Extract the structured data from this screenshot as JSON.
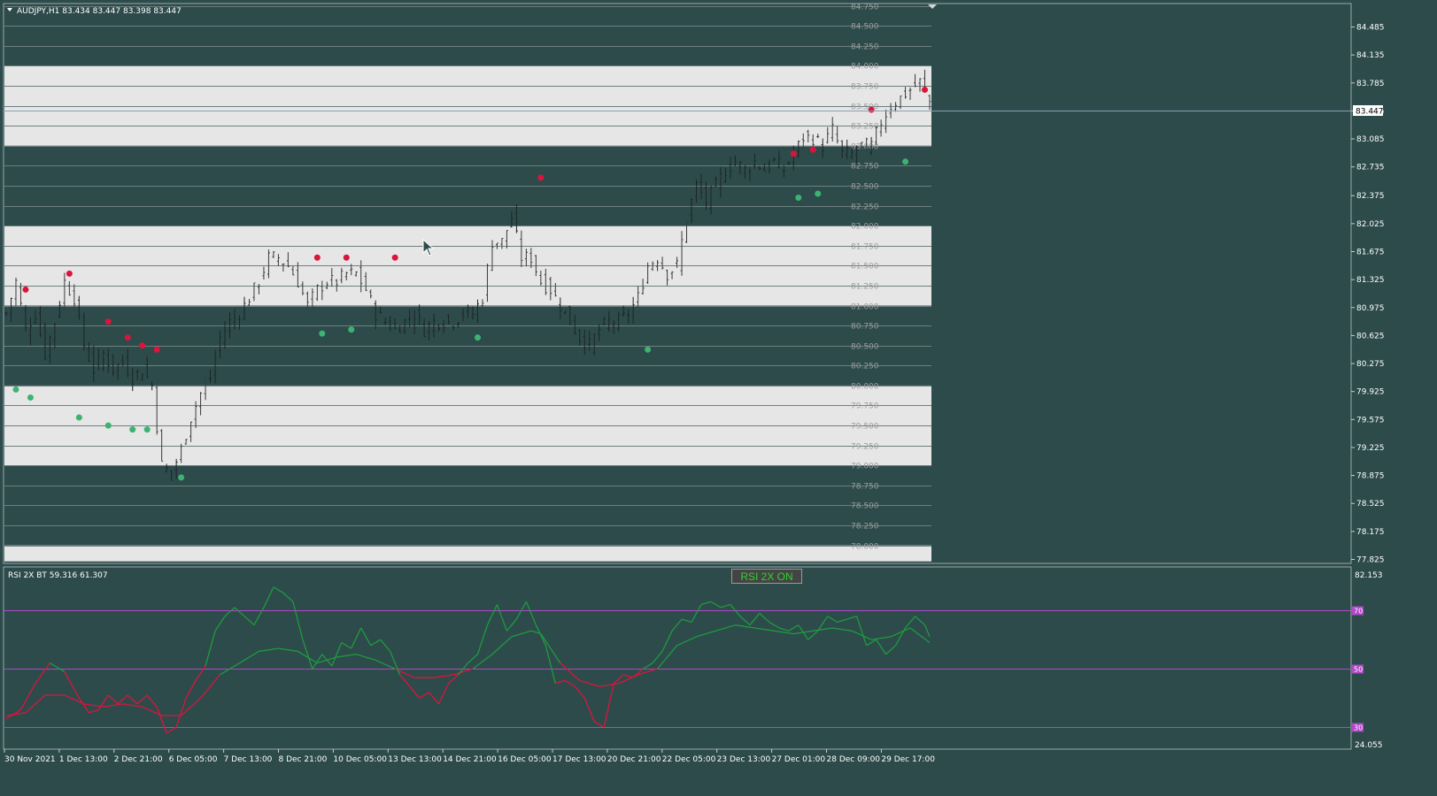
{
  "main_title": "AUDJPY,H1  83.434 83.447 83.398 83.447",
  "rsi_title": "RSI 2X BT 59.316 61.307",
  "rsi_button_label": "RSI 2X ON",
  "current_price_label": "83.447",
  "colors": {
    "background": "#2d4b4b",
    "band": "#e6e6e6",
    "bull": "#2a2a2a",
    "bear": "#2a2a2a",
    "buy_dot": "#3cb371",
    "sell_dot": "#dc143c",
    "rsi_bull": "#1f9a3f",
    "rsi_bear": "#dc143c",
    "rsi_level": "#b048c8",
    "price_line": "#8aa0b0"
  },
  "chart_data": [
    {
      "type": "candlestick",
      "symbol": "AUDJPY",
      "timeframe": "H1",
      "ylim": [
        77.825,
        84.485
      ],
      "price_axis_ticks": [
        "84.485",
        "84.135",
        "83.785",
        "83.435",
        "83.085",
        "82.735",
        "82.375",
        "82.025",
        "81.675",
        "81.325",
        "80.975",
        "80.625",
        "80.275",
        "79.925",
        "79.575",
        "79.225",
        "78.875",
        "78.525",
        "78.175",
        "77.825"
      ],
      "level_labels": [
        "84.750",
        "84.500",
        "84.250",
        "84.000",
        "83.750",
        "83.500",
        "83.250",
        "83.000",
        "82.750",
        "82.500",
        "82.250",
        "82.000",
        "81.750",
        "81.500",
        "81.250",
        "81.000",
        "80.750",
        "80.500",
        "80.250",
        "80.000",
        "79.750",
        "79.500",
        "79.250",
        "79.000",
        "78.750",
        "78.500",
        "78.250",
        "78.000"
      ],
      "bands": [
        [
          83.0,
          84.0
        ],
        [
          81.0,
          82.0
        ],
        [
          79.0,
          80.0
        ],
        [
          77.8,
          78.0
        ]
      ],
      "x_labels": [
        "30 Nov 2021",
        "1 Dec 13:00",
        "2 Dec 21:00",
        "6 Dec 05:00",
        "7 Dec 13:00",
        "8 Dec 21:00",
        "10 Dec 05:00",
        "13 Dec 13:00",
        "14 Dec 21:00",
        "16 Dec 05:00",
        "17 Dec 13:00",
        "20 Dec 21:00",
        "22 Dec 05:00",
        "23 Dec 13:00",
        "27 Dec 01:00",
        "28 Dec 09:00",
        "29 Dec 17:00"
      ],
      "current_price": 83.447,
      "close_path": [
        [
          0,
          80.9
        ],
        [
          2,
          81.3
        ],
        [
          4,
          80.7
        ],
        [
          6,
          80.9
        ],
        [
          8,
          80.4
        ],
        [
          10,
          80.8
        ],
        [
          12,
          81.3
        ],
        [
          14,
          81.1
        ],
        [
          16,
          80.5
        ],
        [
          18,
          80.2
        ],
        [
          20,
          80.4
        ],
        [
          22,
          80.2
        ],
        [
          24,
          80.3
        ],
        [
          26,
          80.1
        ],
        [
          28,
          80.2
        ],
        [
          30,
          80.0
        ],
        [
          32,
          79.0
        ],
        [
          34,
          78.9
        ],
        [
          36,
          79.2
        ],
        [
          38,
          79.6
        ],
        [
          40,
          79.9
        ],
        [
          42,
          80.1
        ],
        [
          44,
          80.6
        ],
        [
          46,
          80.8
        ],
        [
          48,
          80.9
        ],
        [
          50,
          81.1
        ],
        [
          52,
          81.3
        ],
        [
          54,
          81.6
        ],
        [
          56,
          81.6
        ],
        [
          58,
          81.5
        ],
        [
          60,
          81.3
        ],
        [
          62,
          81.0
        ],
        [
          64,
          81.2
        ],
        [
          66,
          81.3
        ],
        [
          68,
          81.3
        ],
        [
          70,
          81.4
        ],
        [
          72,
          81.4
        ],
        [
          74,
          81.2
        ],
        [
          76,
          80.9
        ],
        [
          78,
          80.8
        ],
        [
          80,
          80.7
        ],
        [
          82,
          80.8
        ],
        [
          84,
          80.9
        ],
        [
          86,
          80.7
        ],
        [
          88,
          80.8
        ],
        [
          90,
          80.8
        ],
        [
          92,
          80.8
        ],
        [
          94,
          80.9
        ],
        [
          96,
          80.9
        ],
        [
          98,
          81.1
        ],
        [
          100,
          81.8
        ],
        [
          102,
          81.8
        ],
        [
          104,
          82.1
        ],
        [
          106,
          81.6
        ],
        [
          108,
          81.6
        ],
        [
          110,
          81.3
        ],
        [
          112,
          81.2
        ],
        [
          114,
          81.0
        ],
        [
          116,
          80.8
        ],
        [
          118,
          80.6
        ],
        [
          120,
          80.5
        ],
        [
          122,
          80.7
        ],
        [
          124,
          80.8
        ],
        [
          126,
          80.8
        ],
        [
          128,
          80.9
        ],
        [
          130,
          81.1
        ],
        [
          132,
          81.5
        ],
        [
          134,
          81.6
        ],
        [
          136,
          81.4
        ],
        [
          138,
          81.5
        ],
        [
          140,
          82.1
        ],
        [
          142,
          82.5
        ],
        [
          144,
          82.3
        ],
        [
          146,
          82.5
        ],
        [
          148,
          82.7
        ],
        [
          150,
          82.8
        ],
        [
          152,
          82.7
        ],
        [
          154,
          82.8
        ],
        [
          156,
          82.7
        ],
        [
          158,
          82.8
        ],
        [
          160,
          82.7
        ],
        [
          162,
          82.9
        ],
        [
          164,
          83.1
        ],
        [
          166,
          83.1
        ],
        [
          168,
          83.0
        ],
        [
          170,
          83.2
        ],
        [
          172,
          82.9
        ],
        [
          174,
          82.9
        ],
        [
          176,
          83.0
        ],
        [
          178,
          83.0
        ],
        [
          180,
          83.3
        ],
        [
          182,
          83.5
        ],
        [
          184,
          83.6
        ],
        [
          186,
          83.7
        ],
        [
          188,
          83.8
        ],
        [
          190,
          83.55
        ]
      ],
      "n_bars": 191,
      "sell_signals": [
        [
          4,
          81.2
        ],
        [
          13,
          81.4
        ],
        [
          21,
          80.8
        ],
        [
          25,
          80.6
        ],
        [
          28,
          80.5
        ],
        [
          31,
          80.45
        ],
        [
          64,
          81.6
        ],
        [
          70,
          81.6
        ],
        [
          80,
          81.6
        ],
        [
          110,
          82.6
        ],
        [
          162,
          82.9
        ],
        [
          166,
          82.95
        ],
        [
          178,
          83.45
        ],
        [
          189,
          83.7
        ]
      ],
      "buy_signals": [
        [
          2,
          79.95
        ],
        [
          5,
          79.85
        ],
        [
          15,
          79.6
        ],
        [
          21,
          79.5
        ],
        [
          26,
          79.45
        ],
        [
          29,
          79.45
        ],
        [
          36,
          78.85
        ],
        [
          65,
          80.65
        ],
        [
          71,
          80.7
        ],
        [
          97,
          80.6
        ],
        [
          132,
          80.45
        ],
        [
          163,
          82.35
        ],
        [
          167,
          82.4
        ],
        [
          185,
          82.8
        ]
      ]
    },
    {
      "type": "line",
      "title": "RSI 2X BT 59.316 61.307",
      "ylim": [
        24.055,
        82.153
      ],
      "axis_ticks": [
        "82.153",
        "24.055"
      ],
      "levels": [
        70,
        50,
        30
      ],
      "fast": [
        [
          0,
          33
        ],
        [
          3,
          36
        ],
        [
          6,
          45
        ],
        [
          9,
          52
        ],
        [
          12,
          49
        ],
        [
          15,
          40
        ],
        [
          17,
          35
        ],
        [
          19,
          36
        ],
        [
          21,
          41
        ],
        [
          23,
          38
        ],
        [
          25,
          41
        ],
        [
          27,
          38
        ],
        [
          29,
          41
        ],
        [
          31,
          37
        ],
        [
          33,
          28
        ],
        [
          35,
          30
        ],
        [
          37,
          40
        ],
        [
          39,
          46
        ],
        [
          41,
          51
        ],
        [
          43,
          63
        ],
        [
          45,
          68
        ],
        [
          47,
          71
        ],
        [
          49,
          68
        ],
        [
          51,
          65
        ],
        [
          53,
          71
        ],
        [
          55,
          78
        ],
        [
          57,
          76
        ],
        [
          59,
          73
        ],
        [
          61,
          60
        ],
        [
          63,
          50
        ],
        [
          65,
          55
        ],
        [
          67,
          51
        ],
        [
          69,
          59
        ],
        [
          71,
          57
        ],
        [
          73,
          64
        ],
        [
          75,
          58
        ],
        [
          77,
          60
        ],
        [
          79,
          56
        ],
        [
          81,
          48
        ],
        [
          83,
          44
        ],
        [
          85,
          40
        ],
        [
          87,
          42
        ],
        [
          89,
          38
        ],
        [
          91,
          45
        ],
        [
          93,
          48
        ],
        [
          95,
          52
        ],
        [
          97,
          55
        ],
        [
          99,
          65
        ],
        [
          101,
          72
        ],
        [
          103,
          63
        ],
        [
          105,
          67
        ],
        [
          107,
          73
        ],
        [
          109,
          65
        ],
        [
          111,
          58
        ],
        [
          113,
          45
        ],
        [
          115,
          46
        ],
        [
          117,
          44
        ],
        [
          119,
          40
        ],
        [
          121,
          32
        ],
        [
          123,
          30
        ],
        [
          125,
          45
        ],
        [
          127,
          48
        ],
        [
          129,
          47
        ],
        [
          131,
          50
        ],
        [
          133,
          52
        ],
        [
          135,
          56
        ],
        [
          137,
          63
        ],
        [
          139,
          67
        ],
        [
          141,
          66
        ],
        [
          143,
          72
        ],
        [
          145,
          73
        ],
        [
          147,
          71
        ],
        [
          149,
          72
        ],
        [
          151,
          68
        ],
        [
          153,
          65
        ],
        [
          155,
          69
        ],
        [
          157,
          66
        ],
        [
          159,
          64
        ],
        [
          161,
          63
        ],
        [
          163,
          65
        ],
        [
          165,
          60
        ],
        [
          167,
          63
        ],
        [
          169,
          68
        ],
        [
          171,
          66
        ],
        [
          173,
          67
        ],
        [
          175,
          68
        ],
        [
          177,
          58
        ],
        [
          179,
          60
        ],
        [
          181,
          55
        ],
        [
          183,
          58
        ],
        [
          185,
          64
        ],
        [
          187,
          68
        ],
        [
          189,
          65
        ],
        [
          190,
          61
        ]
      ],
      "slow": [
        [
          0,
          34
        ],
        [
          4,
          35
        ],
        [
          8,
          41
        ],
        [
          12,
          41
        ],
        [
          16,
          38
        ],
        [
          20,
          37
        ],
        [
          24,
          38
        ],
        [
          28,
          37
        ],
        [
          32,
          34
        ],
        [
          36,
          34
        ],
        [
          40,
          40
        ],
        [
          44,
          48
        ],
        [
          48,
          52
        ],
        [
          52,
          56
        ],
        [
          56,
          57
        ],
        [
          60,
          56
        ],
        [
          64,
          52
        ],
        [
          68,
          54
        ],
        [
          72,
          55
        ],
        [
          76,
          53
        ],
        [
          80,
          50
        ],
        [
          84,
          47
        ],
        [
          88,
          47
        ],
        [
          92,
          48
        ],
        [
          96,
          50
        ],
        [
          100,
          55
        ],
        [
          104,
          61
        ],
        [
          108,
          63
        ],
        [
          110,
          62
        ],
        [
          114,
          52
        ],
        [
          118,
          46
        ],
        [
          122,
          44
        ],
        [
          126,
          45
        ],
        [
          130,
          48
        ],
        [
          134,
          50
        ],
        [
          138,
          58
        ],
        [
          142,
          61
        ],
        [
          146,
          63
        ],
        [
          150,
          65
        ],
        [
          154,
          64
        ],
        [
          158,
          63
        ],
        [
          162,
          62
        ],
        [
          166,
          63
        ],
        [
          170,
          64
        ],
        [
          174,
          63
        ],
        [
          178,
          60
        ],
        [
          182,
          61
        ],
        [
          186,
          64
        ],
        [
          190,
          59
        ]
      ]
    }
  ]
}
